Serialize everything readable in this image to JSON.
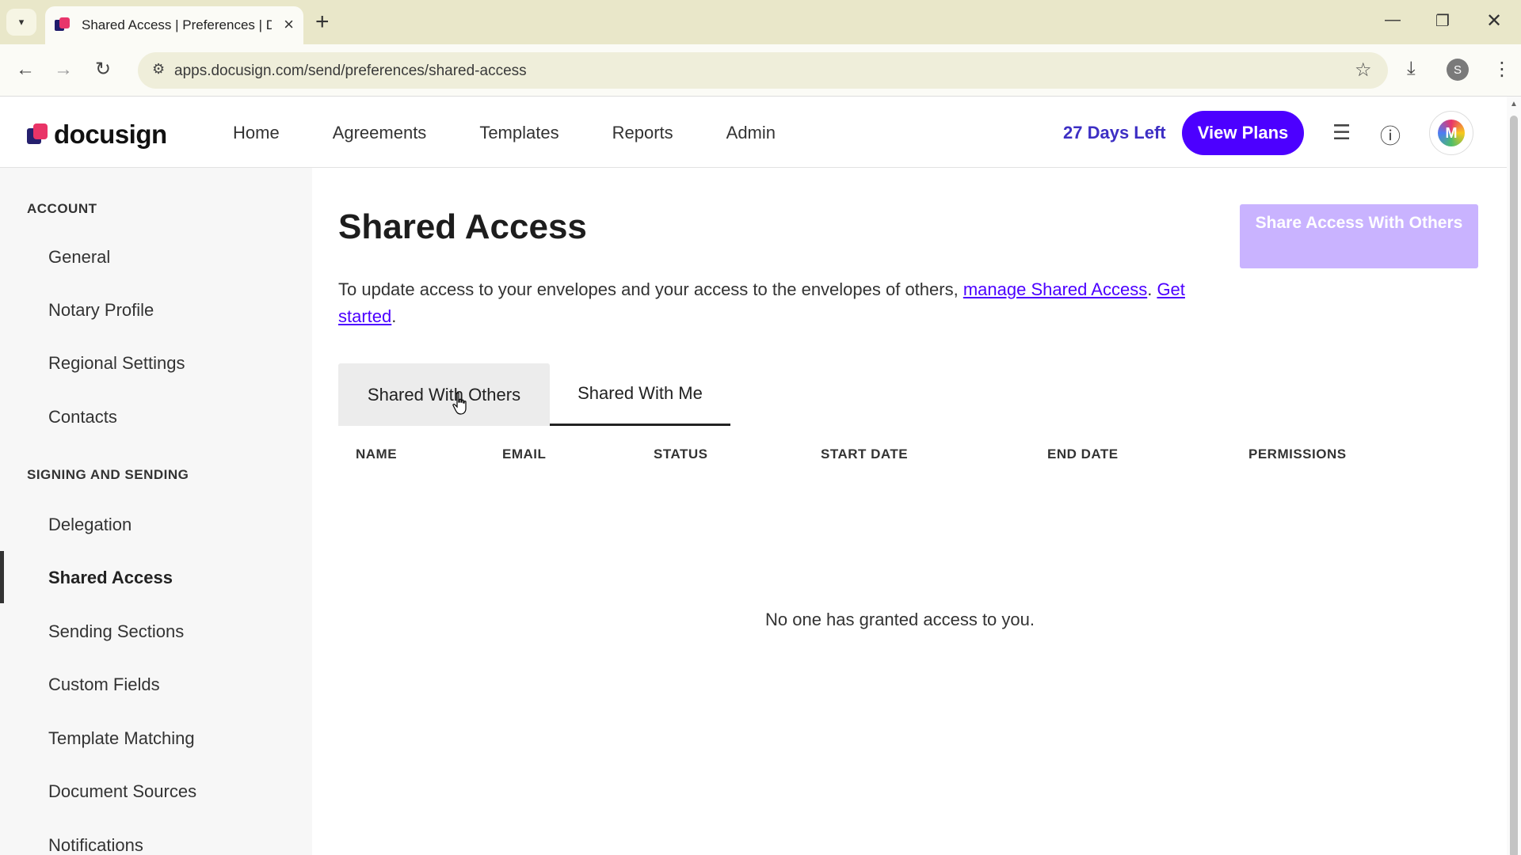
{
  "browser": {
    "tab_title": "Shared Access | Preferences | Do",
    "url": "apps.docusign.com/send/preferences/shared-access",
    "profile_initial": "S"
  },
  "header": {
    "logo_text": "docusign",
    "nav": [
      "Home",
      "Agreements",
      "Templates",
      "Reports",
      "Admin"
    ],
    "trial_text": "27 Days Left",
    "view_plans": "View Plans",
    "avatar_initial": "M"
  },
  "sidebar": {
    "account_heading": "ACCOUNT",
    "account_items": [
      "General",
      "Notary Profile",
      "Regional Settings",
      "Contacts"
    ],
    "signing_heading": "SIGNING AND SENDING",
    "signing_items": [
      "Delegation",
      "Shared Access",
      "Sending Sections",
      "Custom Fields",
      "Template Matching",
      "Document Sources",
      "Notifications"
    ]
  },
  "main": {
    "title": "Shared Access",
    "share_button": "Share Access With Others",
    "desc_prefix": "To update access to your envelopes and your access to the envelopes of others, ",
    "desc_link1": "manage Shared Access",
    "desc_sep": ". ",
    "desc_link2": "Get started",
    "desc_suffix": ".",
    "tabs": [
      "Shared With Others",
      "Shared With Me"
    ],
    "columns": [
      "NAME",
      "EMAIL",
      "STATUS",
      "START DATE",
      "END DATE",
      "PERMISSIONS"
    ],
    "empty_message": "No one has granted access to you."
  },
  "colors": {
    "accent": "#4c00ff",
    "share_button_disabled": "#c9b3ff",
    "trial_text": "#3d2fc4"
  }
}
